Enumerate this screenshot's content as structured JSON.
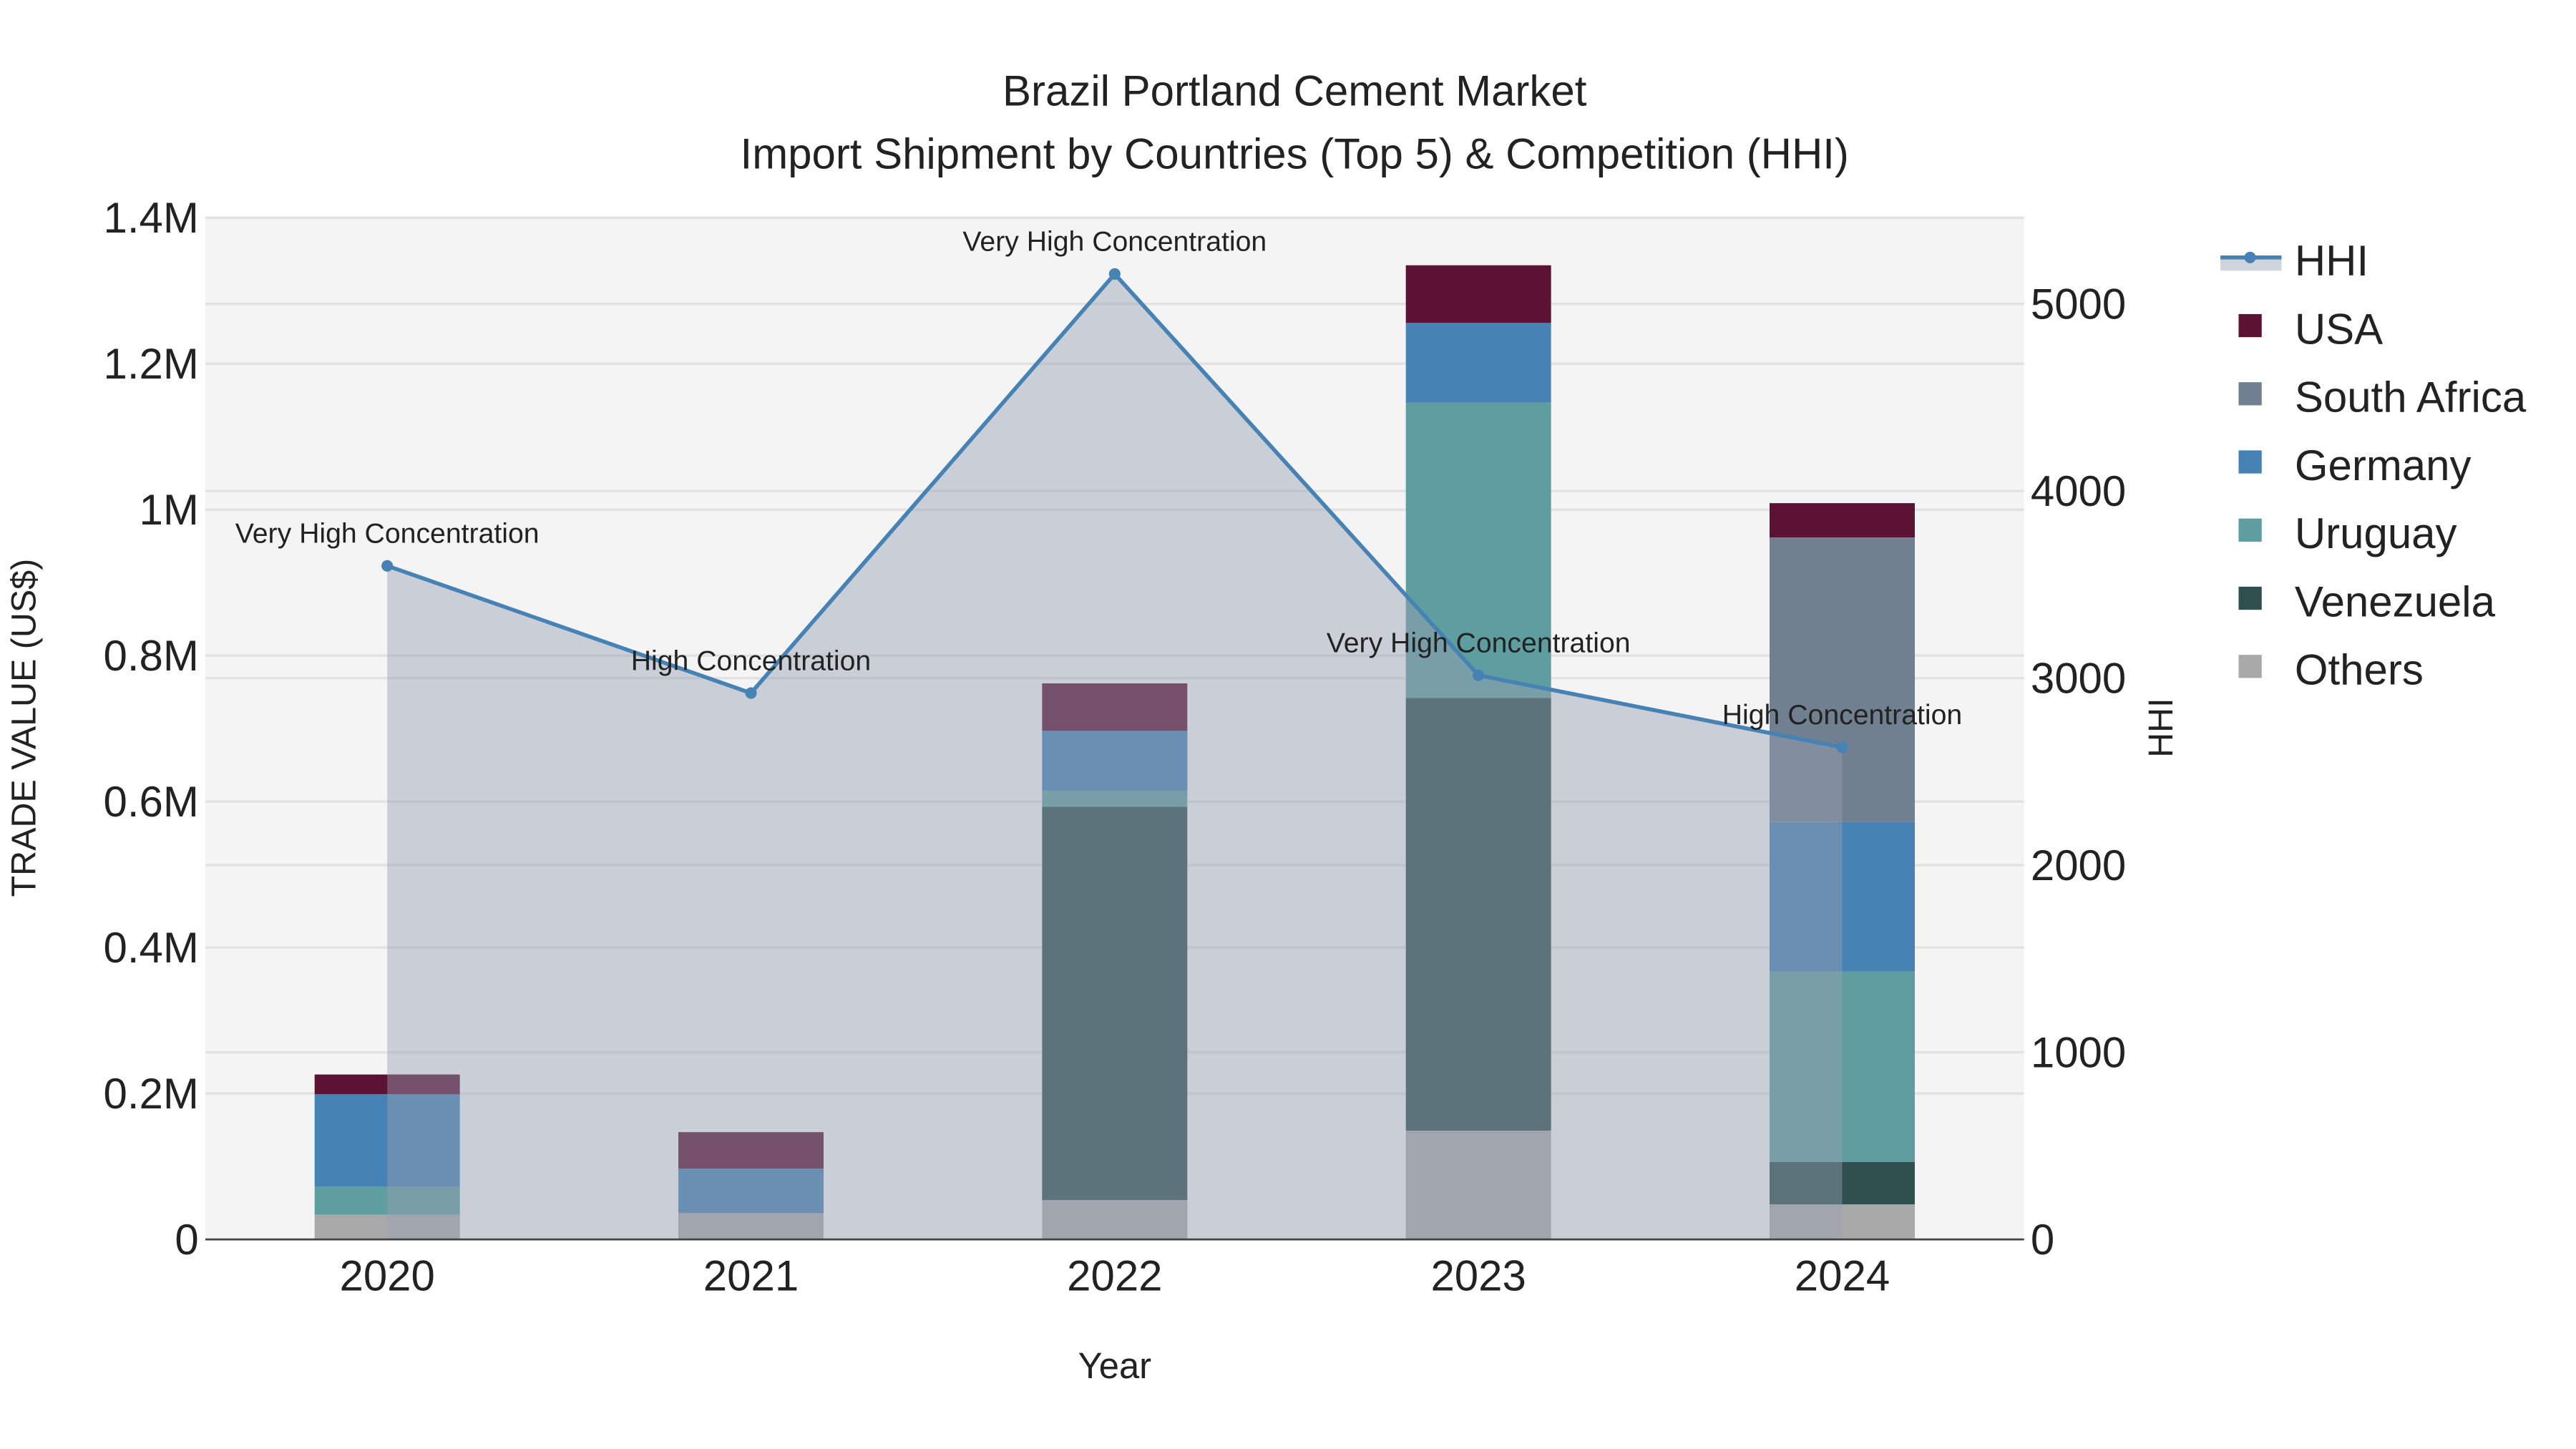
{
  "chart_data": {
    "type": "bar",
    "title": "Brazil Portland Cement Market",
    "subtitle": "Import Shipment by Countries (Top 5) & Competition (HHI)",
    "xlabel": "Year",
    "ylabel": "TRADE VALUE (US$)",
    "y2label": "HHI",
    "categories": [
      "2020",
      "2021",
      "2022",
      "2023",
      "2024"
    ],
    "ylim": [
      0,
      1400000
    ],
    "y_ticks": [
      0,
      200000,
      400000,
      600000,
      800000,
      1000000,
      1200000,
      1400000
    ],
    "y_tick_labels": [
      "0",
      "0.2M",
      "0.4M",
      "0.6M",
      "0.8M",
      "1M",
      "1.2M",
      "1.4M"
    ],
    "y2lim": [
      0,
      5460
    ],
    "y2_ticks": [
      0,
      1000,
      2000,
      3000,
      4000,
      5000
    ],
    "y2_tick_labels": [
      "0",
      "1000",
      "2000",
      "3000",
      "4000",
      "5000"
    ],
    "grid": true,
    "legend_placement": "right",
    "series": [
      {
        "name": "Others",
        "color": "#a9a9a9",
        "values": [
          34000,
          36000,
          54000,
          149000,
          48000
        ]
      },
      {
        "name": "Venezuela",
        "color": "#2f4f4f",
        "values": [
          0,
          0,
          539000,
          593000,
          58000
        ]
      },
      {
        "name": "Uruguay",
        "color": "#5f9ea0",
        "values": [
          38000,
          0,
          22000,
          405000,
          261000
        ]
      },
      {
        "name": "Germany",
        "color": "#4682b4",
        "values": [
          127000,
          61000,
          82000,
          109000,
          205000
        ]
      },
      {
        "name": "South Africa",
        "color": "#708090",
        "values": [
          0,
          0,
          0,
          0,
          390000
        ]
      },
      {
        "name": "USA",
        "color": "#5c1233",
        "values": [
          27000,
          50000,
          65000,
          79000,
          47000
        ]
      }
    ],
    "hhi": {
      "name": "HHI",
      "color": "#4682b4",
      "values": [
        3600,
        2920,
        5160,
        3015,
        2630
      ],
      "annotations": [
        "Very High Concentration",
        "High Concentration",
        "Very High Concentration",
        "Very High Concentration",
        "High Concentration"
      ]
    },
    "legend_order": [
      "HHI",
      "USA",
      "South Africa",
      "Germany",
      "Uruguay",
      "Venezuela",
      "Others"
    ]
  }
}
